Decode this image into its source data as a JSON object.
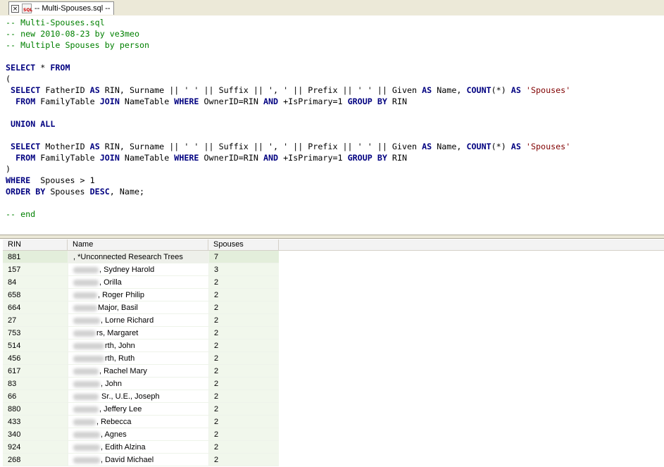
{
  "tab": {
    "close_glyph": "×",
    "icon": "sql-file-icon",
    "icon_text": "SQL",
    "title": "-- Multi-Spouses.sql --"
  },
  "editor": {
    "lines": [
      [
        {
          "t": "cm",
          "v": "-- Multi-Spouses.sql"
        }
      ],
      [
        {
          "t": "cm",
          "v": "-- new 2010-08-23 by ve3meo"
        }
      ],
      [
        {
          "t": "cm",
          "v": "-- Multiple Spouses by person"
        }
      ],
      [],
      [
        {
          "t": "kw",
          "v": "SELECT"
        },
        {
          "t": "plain",
          "v": " * "
        },
        {
          "t": "kw",
          "v": "FROM"
        }
      ],
      [
        {
          "t": "plain",
          "v": "("
        }
      ],
      [
        {
          "t": "plain",
          "v": " "
        },
        {
          "t": "kw",
          "v": "SELECT"
        },
        {
          "t": "plain",
          "v": " FatherID "
        },
        {
          "t": "kw",
          "v": "AS"
        },
        {
          "t": "plain",
          "v": " RIN, Surname || ' ' || Suffix || ', ' || Prefix || ' ' || Given "
        },
        {
          "t": "kw",
          "v": "AS"
        },
        {
          "t": "plain",
          "v": " Name, "
        },
        {
          "t": "kw",
          "v": "COUNT"
        },
        {
          "t": "plain",
          "v": "(*) "
        },
        {
          "t": "kw",
          "v": "AS"
        },
        {
          "t": "plain",
          "v": " "
        },
        {
          "t": "str",
          "v": "'Spouses'"
        }
      ],
      [
        {
          "t": "plain",
          "v": "  "
        },
        {
          "t": "kw",
          "v": "FROM"
        },
        {
          "t": "plain",
          "v": " FamilyTable "
        },
        {
          "t": "kw",
          "v": "JOIN"
        },
        {
          "t": "plain",
          "v": " NameTable "
        },
        {
          "t": "kw",
          "v": "WHERE"
        },
        {
          "t": "plain",
          "v": " OwnerID=RIN "
        },
        {
          "t": "kw",
          "v": "AND"
        },
        {
          "t": "plain",
          "v": " +IsPrimary=1 "
        },
        {
          "t": "kw",
          "v": "GROUP BY"
        },
        {
          "t": "plain",
          "v": " RIN"
        }
      ],
      [],
      [
        {
          "t": "plain",
          "v": " "
        },
        {
          "t": "kw",
          "v": "UNION ALL"
        }
      ],
      [],
      [
        {
          "t": "plain",
          "v": " "
        },
        {
          "t": "kw",
          "v": "SELECT"
        },
        {
          "t": "plain",
          "v": " MotherID "
        },
        {
          "t": "kw",
          "v": "AS"
        },
        {
          "t": "plain",
          "v": " RIN, Surname || ' ' || Suffix || ', ' || Prefix || ' ' || Given "
        },
        {
          "t": "kw",
          "v": "AS"
        },
        {
          "t": "plain",
          "v": " Name, "
        },
        {
          "t": "kw",
          "v": "COUNT"
        },
        {
          "t": "plain",
          "v": "(*) "
        },
        {
          "t": "kw",
          "v": "AS"
        },
        {
          "t": "plain",
          "v": " "
        },
        {
          "t": "str",
          "v": "'Spouses'"
        }
      ],
      [
        {
          "t": "plain",
          "v": "  "
        },
        {
          "t": "kw",
          "v": "FROM"
        },
        {
          "t": "plain",
          "v": " FamilyTable "
        },
        {
          "t": "kw",
          "v": "JOIN"
        },
        {
          "t": "plain",
          "v": " NameTable "
        },
        {
          "t": "kw",
          "v": "WHERE"
        },
        {
          "t": "plain",
          "v": " OwnerID=RIN "
        },
        {
          "t": "kw",
          "v": "AND"
        },
        {
          "t": "plain",
          "v": " +IsPrimary=1 "
        },
        {
          "t": "kw",
          "v": "GROUP BY"
        },
        {
          "t": "plain",
          "v": " RIN"
        }
      ],
      [
        {
          "t": "plain",
          "v": ")"
        }
      ],
      [
        {
          "t": "kw",
          "v": "WHERE"
        },
        {
          "t": "plain",
          "v": "  Spouses > 1"
        }
      ],
      [
        {
          "t": "kw",
          "v": "ORDER BY"
        },
        {
          "t": "plain",
          "v": " Spouses "
        },
        {
          "t": "kw",
          "v": "DESC"
        },
        {
          "t": "plain",
          "v": ", Name;"
        }
      ],
      [],
      [
        {
          "t": "cm",
          "v": "-- end"
        }
      ]
    ]
  },
  "results": {
    "columns": [
      "RIN",
      "Name",
      "Spouses"
    ],
    "rows": [
      {
        "rin": "881",
        "blur": 0,
        "name": ", *Unconnected Research Trees",
        "spouses": "7"
      },
      {
        "rin": "157",
        "blur": 36,
        "name": ", Sydney Harold",
        "spouses": "3"
      },
      {
        "rin": "84",
        "blur": 36,
        "name": ", Orilla",
        "spouses": "2"
      },
      {
        "rin": "658",
        "blur": 34,
        "name": ", Roger Philip",
        "spouses": "2"
      },
      {
        "rin": "664",
        "blur": 34,
        "name": "Major, Basil",
        "spouses": "2"
      },
      {
        "rin": "27",
        "blur": 38,
        "name": ", Lorne Richard",
        "spouses": "2"
      },
      {
        "rin": "753",
        "blur": 32,
        "name": "rs, Margaret",
        "spouses": "2"
      },
      {
        "rin": "514",
        "blur": 44,
        "name": "rth, John",
        "spouses": "2"
      },
      {
        "rin": "456",
        "blur": 44,
        "name": "rth, Ruth",
        "spouses": "2"
      },
      {
        "rin": "617",
        "blur": 36,
        "name": ", Rachel Mary",
        "spouses": "2"
      },
      {
        "rin": "83",
        "blur": 38,
        "name": ", John",
        "spouses": "2"
      },
      {
        "rin": "66",
        "blur": 36,
        "name": " Sr., U.E., Joseph",
        "spouses": "2"
      },
      {
        "rin": "880",
        "blur": 36,
        "name": ", Jeffery Lee",
        "spouses": "2"
      },
      {
        "rin": "433",
        "blur": 32,
        "name": ", Rebecca",
        "spouses": "2"
      },
      {
        "rin": "340",
        "blur": 38,
        "name": ", Agnes",
        "spouses": "2"
      },
      {
        "rin": "924",
        "blur": 38,
        "name": ", Edith Alzina",
        "spouses": "2"
      },
      {
        "rin": "268",
        "blur": 38,
        "name": ", David Michael",
        "spouses": "2"
      }
    ]
  }
}
